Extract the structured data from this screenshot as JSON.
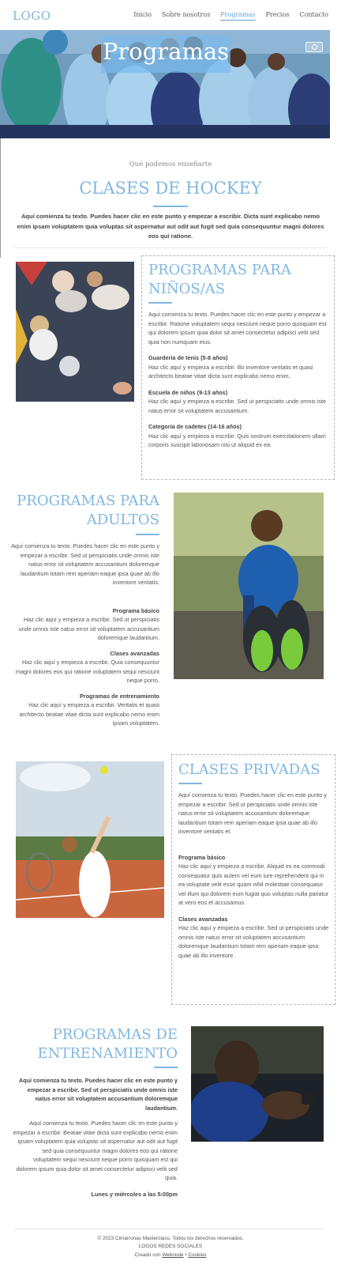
{
  "header": {
    "logo": "LOGO",
    "nav": [
      "Inicio",
      "Sobre nosotros",
      "Programas",
      "Precios",
      "Contacto"
    ],
    "active_index": 2
  },
  "hero": {
    "title": "Programas"
  },
  "intro": {
    "subtitle": "Qué podemos enseñarte",
    "title": "CLASES DE HOCKEY",
    "text": "Aquí comienza tu texto. Puedes hacer clic en este punto y empezar a escribir. Dicta sunt explicabo nemo enim ipsam voluptatem quia voluptas sit aspernatur aut odit aut fugit sed quia consequuntur magni dolores eos qui ratione."
  },
  "kids": {
    "title": "PROGRAMAS PARA NIÑOS/AS",
    "text": "Aquí comienza tu texto. Puedes hacer clic en este punto y empezar a escribir. Ratione voluptatem sequi nesciunt neque porro quisquam est qui dolorem ipsum quia dolor sit amet consectetur adipisci velit sed quia non numquam eius.",
    "items": [
      {
        "heading": "Guardería de tenis (5-8 años)",
        "text": "Haz clic aquí y empieza a escribir. Illo inventore veritatis et quasi architecto beatae vitae dicta sunt explicabo nemo enim."
      },
      {
        "heading": "Escuela de niños (9-13 años)",
        "text": "Haz clic aquí y empieza a escribir. Sed ut perspiciatis unde omnis iste natus error sit voluptatem accusantium."
      },
      {
        "heading": "Categoría de cadetes (14-16 años)",
        "text": "Haz clic aquí y empieza a escribir. Quis nostrum exercitationem ullam corporis suscipit laboriosam nisi ut aliquid ex ea."
      }
    ]
  },
  "adults": {
    "title": "PROGRAMAS PARA ADULTOS",
    "text": "Aquí comienza tu texto. Puedes hacer clic en este punto y empezar a escribir. Sed ut perspiciatis unde omnis iste natus error sit voluptatem accusantium doloremque laudantium totam rem aperiam eaque ipsa quae ab illo inventore veritatis.",
    "items": [
      {
        "heading": "Programa básico",
        "text": "Haz clic aquí y empieza a escribir. Sed ut perspiciatis unde omnis iste natus error sit voluptatem accusantium doloremque laudantium."
      },
      {
        "heading": "Clases avanzadas",
        "text": "Haz clic aquí y empieza a escribir. Quia consequuntur magni dolores eos qui ratione voluptatem sequi nesciunt neque porro."
      },
      {
        "heading": "Programas de entrenamiento",
        "text": "Haz clic aquí y empieza a escribir. Veritatis et quasi architecto beatae vitae dicta sunt explicabo nemo enim ipsam voluptatem."
      }
    ]
  },
  "private": {
    "title": "CLASES PRIVADAS",
    "text": "Aquí comienza tu texto. Puedes hacer clic en este punto y empezar a escribir. Sed ut perspiciatis unde omnis iste natus error sit voluptatem accusantium doloremque laudantium totam rem aperiam eaque ipsa quae ab illo inventore veritatis et.",
    "items": [
      {
        "heading": "Programa básico",
        "text": "Haz clic aquí y empieza a escribir. Aliquid ex ea commodi consequatur quis autem vel eum iure reprehenderit qui in ea voluptate velit esse quam nihil molestiae consequatur vel illum qui dolorem eum fugiat quo voluptas nulla pariatur at vero eos et accusamus."
      },
      {
        "heading": "Clases avanzadas",
        "text": "Haz clic aquí y empieza a escribir. Sed ut perspiciatis unde omnis iste natus error sit voluptatem accusantium doloremque laudantium totam rem aperiam eaque ipsa quae ab illo inventore."
      }
    ]
  },
  "training": {
    "title": "PROGRAMAS DE ENTRENAMIENTO",
    "lead": "Aquí comienza tu texto. Puedes hacer clic en este punto y empezar a escribir. Sed ut perspiciatis unde omnis iste natus error sit voluptatem accusantium doloremque laudantium.",
    "text": "Aquí comienza tu texto. Puedes hacer clic en este punto y empezar a escribir. Beatae vitae dicta sunt explicabo nemo enim ipsam voluptatem quia voluptas sit aspernatur aut odit aut fugit sed quia consequuntur magni dolores eos qui ratione voluptatem sequi nesciunt neque porro quisquam est qui dolorem ipsum quia dolor sit amet consectetur adipisci velit sed quia.",
    "schedule": "Lunes y miércoles a las 5:00pm"
  },
  "footer": {
    "copyright": "© 2023 Cimarronas Masterclass. Todos los derechos reservados.",
    "social": "LOGOS REDES SOCIALES",
    "created_prefix": "Creado con",
    "created_link": "Webnode",
    "separator": "•",
    "cookies": "Cookies"
  },
  "colors": {
    "accent": "#7fb7e2"
  }
}
